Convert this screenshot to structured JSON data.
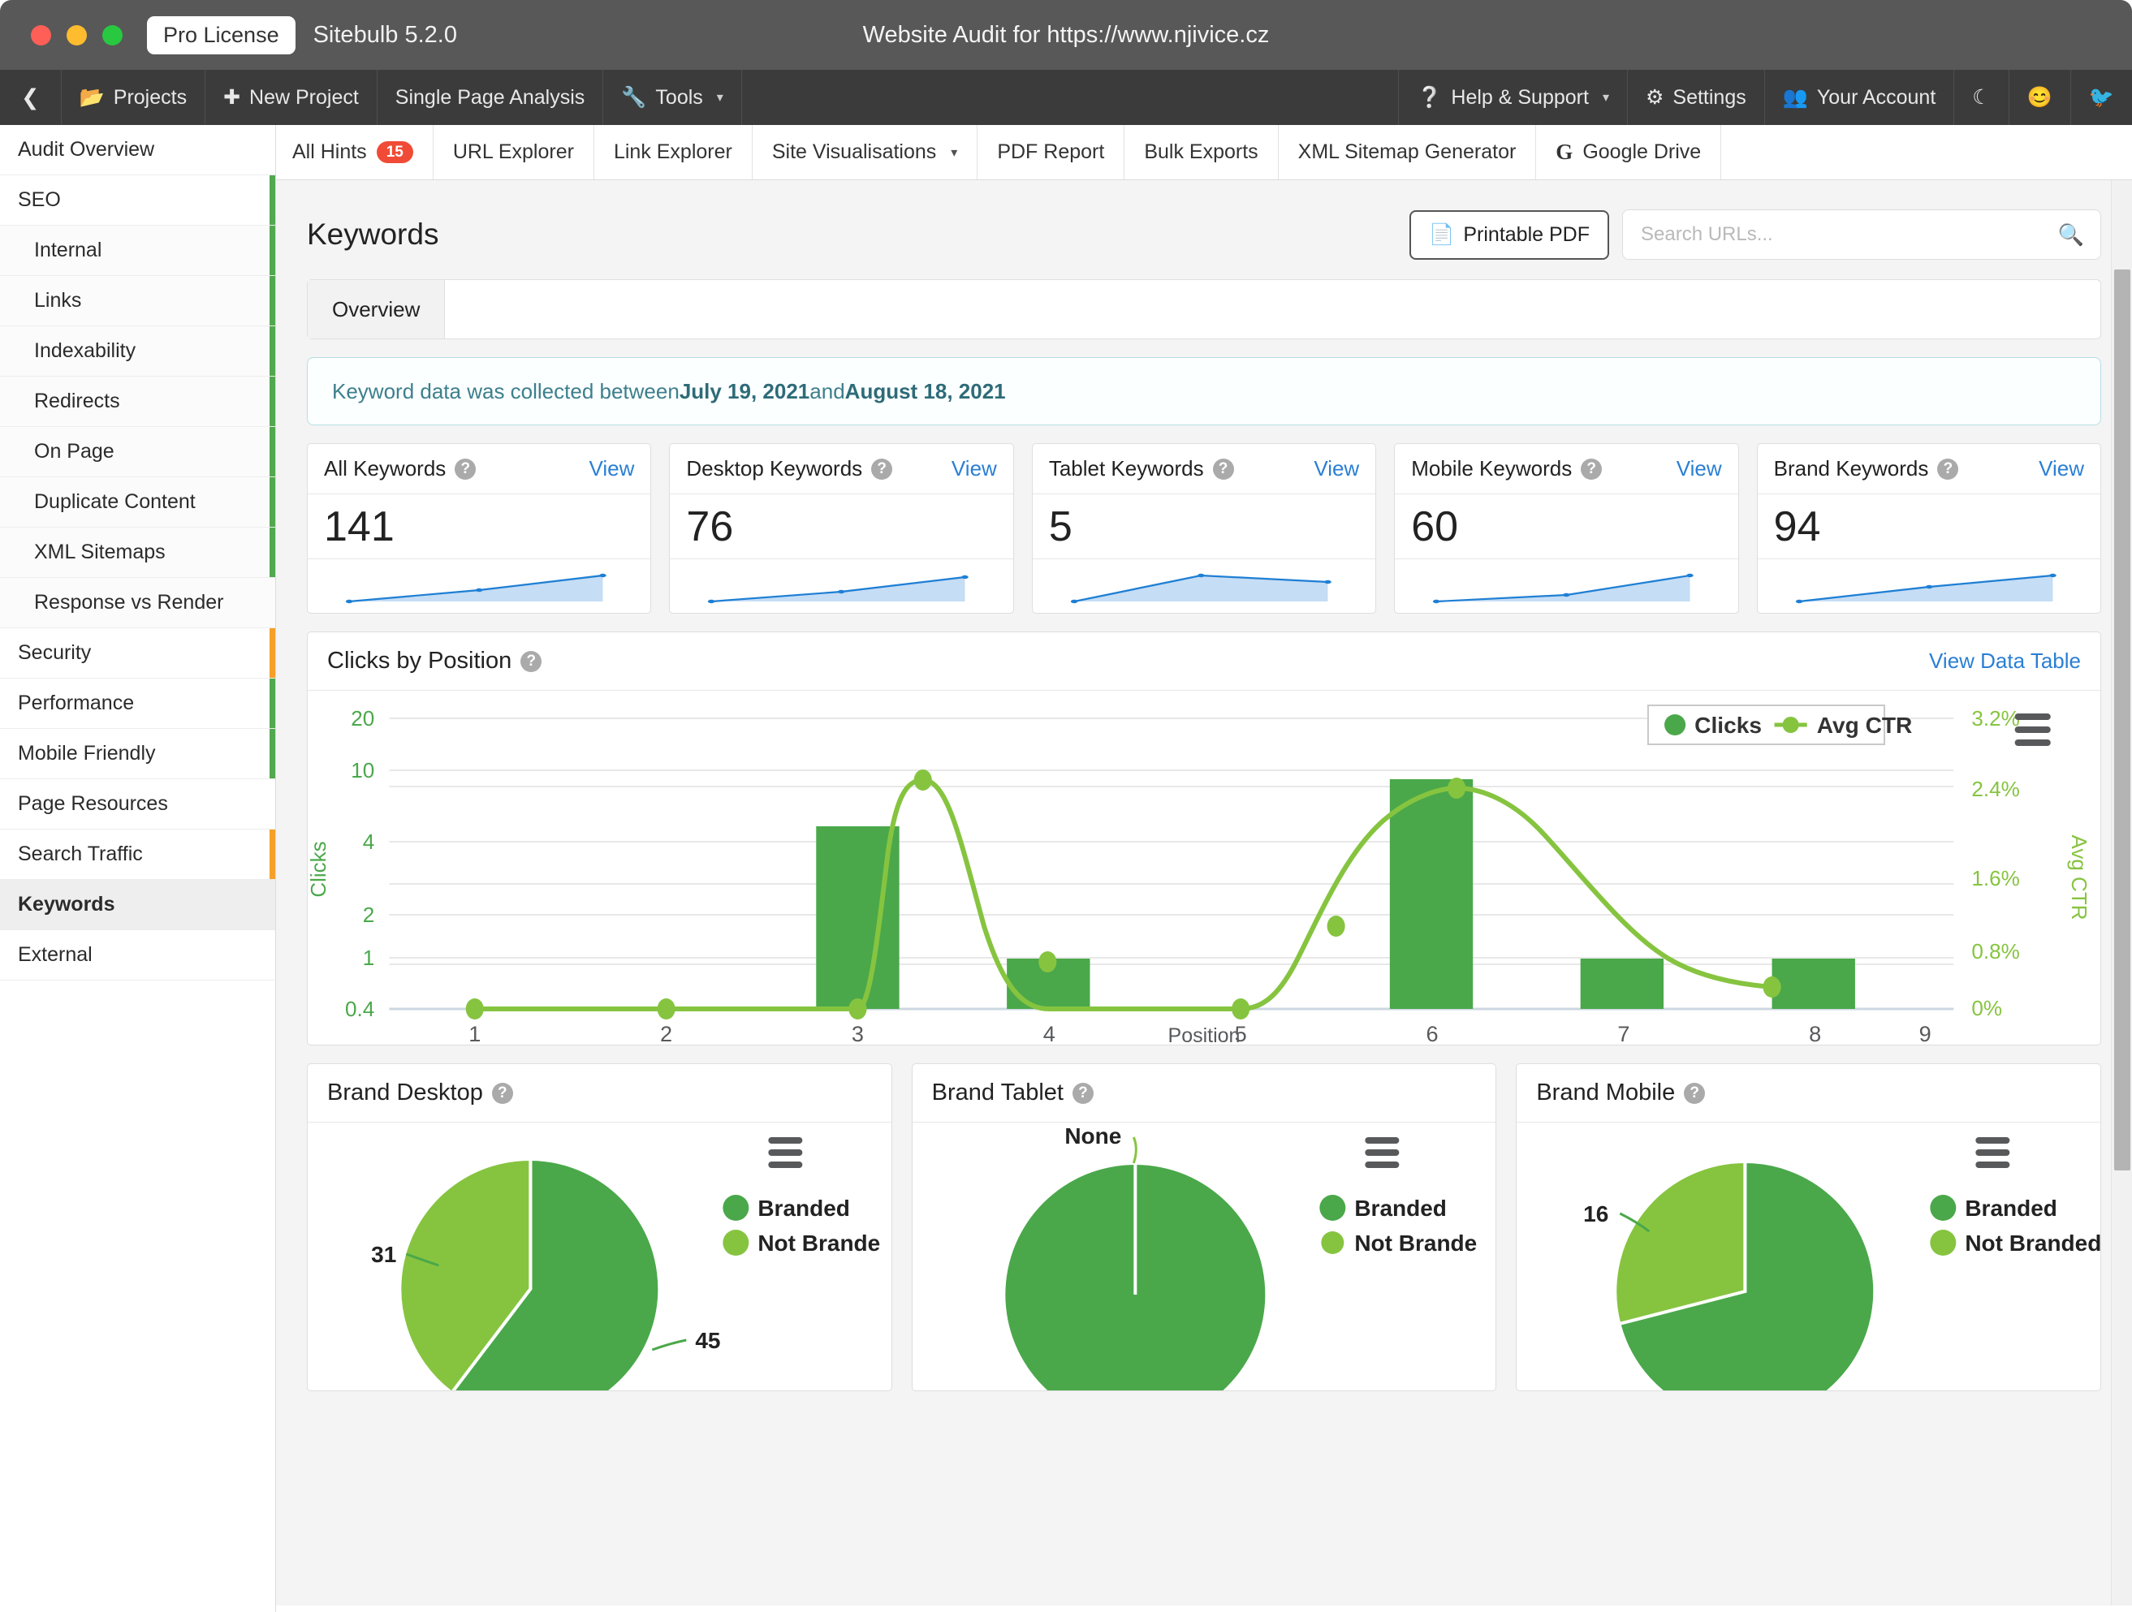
{
  "titlebar": {
    "pro_badge": "Pro License",
    "app_name": "Sitebulb 5.2.0",
    "window_title": "Website Audit for https://www.njivice.cz"
  },
  "menubar": {
    "back_icon": "chevron-left-icon",
    "left_items": [
      {
        "label": "Projects",
        "icon": "folder-icon"
      },
      {
        "label": "New Project",
        "icon": "plus-icon"
      },
      {
        "label": "Single Page Analysis",
        "icon": ""
      },
      {
        "label": "Tools",
        "icon": "wrench-icon",
        "caret": "▾"
      }
    ],
    "right_items": [
      {
        "label": "Help & Support",
        "icon": "question-circle-icon",
        "caret": "▾"
      },
      {
        "label": "Settings",
        "icon": "gears-icon"
      },
      {
        "label": "Your Account",
        "icon": "users-icon"
      },
      {
        "label": "",
        "icon": "moon-icon",
        "glyph": "☾"
      },
      {
        "label": "",
        "icon": "smiley-icon",
        "glyph": "😊"
      },
      {
        "label": "",
        "icon": "twitter-icon",
        "glyph": "🐦"
      }
    ]
  },
  "sidebar": {
    "items": [
      {
        "label": "Audit Overview",
        "level": 0,
        "edge": "",
        "active": false
      },
      {
        "label": "SEO",
        "level": 0,
        "edge": "#52a850",
        "active": false
      },
      {
        "label": "Internal",
        "level": 1,
        "edge": "#52a850",
        "active": false
      },
      {
        "label": "Links",
        "level": 1,
        "edge": "#52a850",
        "active": false
      },
      {
        "label": "Indexability",
        "level": 1,
        "edge": "#52a850",
        "active": false
      },
      {
        "label": "Redirects",
        "level": 1,
        "edge": "#52a850",
        "active": false
      },
      {
        "label": "On Page",
        "level": 1,
        "edge": "#52a850",
        "active": false
      },
      {
        "label": "Duplicate Content",
        "level": 1,
        "edge": "#52a850",
        "active": false
      },
      {
        "label": "XML Sitemaps",
        "level": 1,
        "edge": "#52a850",
        "active": false
      },
      {
        "label": "Response vs Render",
        "level": 1,
        "edge": "",
        "active": false
      },
      {
        "label": "Security",
        "level": 0,
        "edge": "#f5a02a",
        "active": false
      },
      {
        "label": "Performance",
        "level": 0,
        "edge": "#52a850",
        "active": false
      },
      {
        "label": "Mobile Friendly",
        "level": 0,
        "edge": "#52a850",
        "active": false
      },
      {
        "label": "Page Resources",
        "level": 0,
        "edge": "",
        "active": false
      },
      {
        "label": "Search Traffic",
        "level": 0,
        "edge": "#f5a02a",
        "active": false
      },
      {
        "label": "Keywords",
        "level": 0,
        "edge": "",
        "active": true
      },
      {
        "label": "External",
        "level": 0,
        "edge": "",
        "active": false
      }
    ]
  },
  "tabs": [
    {
      "label": "All Hints",
      "badge": "15"
    },
    {
      "label": "URL Explorer",
      "badge": ""
    },
    {
      "label": "Link Explorer",
      "badge": ""
    },
    {
      "label": "Site Visualisations",
      "badge": "",
      "caret": "▾"
    },
    {
      "label": "PDF Report",
      "badge": ""
    },
    {
      "label": "Bulk Exports",
      "badge": ""
    },
    {
      "label": "XML Sitemap Generator",
      "badge": ""
    },
    {
      "label": "Google Drive",
      "badge": "",
      "icon": "google-drive-icon",
      "glyph": "G"
    }
  ],
  "page": {
    "title": "Keywords",
    "printable_pdf_label": "Printable PDF",
    "printable_pdf_icon": "file-pdf-icon",
    "search_placeholder": "Search URLs...",
    "search_value": "",
    "search_icon": "search-icon",
    "subtabs": [
      {
        "label": "Overview",
        "active": true
      }
    ],
    "banner": {
      "prefix": "Keyword data was collected between ",
      "start_date": "July 19, 2021",
      "middle": " and ",
      "end_date": "August 18, 2021"
    }
  },
  "stat_cards": [
    {
      "title": "All Keywords",
      "value": "141",
      "view": "View",
      "spark": [
        8,
        26,
        48
      ]
    },
    {
      "title": "Desktop Keywords",
      "value": "76",
      "view": "View",
      "spark": [
        8,
        26,
        44
      ]
    },
    {
      "title": "Tablet Keywords",
      "value": "5",
      "view": "View",
      "spark": [
        6,
        46,
        34
      ]
    },
    {
      "title": "Mobile Keywords",
      "value": "60",
      "view": "View",
      "spark": [
        6,
        18,
        45
      ]
    },
    {
      "title": "Brand Keywords",
      "value": "94",
      "view": "View",
      "spark": [
        6,
        32,
        48
      ]
    }
  ],
  "clicks_panel": {
    "title": "Clicks by Position",
    "link": "View Data Table",
    "menu_icon": "hamburger-menu-icon"
  },
  "pie_panels": [
    {
      "title": "Brand Desktop",
      "menu_icon": "hamburger-menu-icon"
    },
    {
      "title": "Brand Tablet",
      "menu_icon": "hamburger-menu-icon"
    },
    {
      "title": "Brand Mobile",
      "menu_icon": "hamburger-menu-icon"
    }
  ],
  "chart_data": [
    {
      "type": "bar",
      "title": "Clicks by Position",
      "xlabel": "Position",
      "ylabel": "Clicks",
      "y2label": "Avg CTR",
      "categories": [
        "1",
        "2",
        "3",
        "4",
        "5",
        "6",
        "7",
        "8",
        "9"
      ],
      "yticks": [
        "0.4",
        "1",
        "2",
        "4",
        "10",
        "20"
      ],
      "y2ticks": [
        "0%",
        "0.8%",
        "1.6%",
        "2.4%",
        "3.2%"
      ],
      "ylim": [
        0.4,
        20
      ],
      "y2lim": [
        0,
        3.2
      ],
      "yscale": "log",
      "grid": true,
      "legend": "top-right",
      "series": [
        {
          "name": "Clicks",
          "type": "bar",
          "values": [
            0,
            0,
            0,
            5,
            1,
            0,
            11,
            1,
            1
          ]
        },
        {
          "name": "Avg CTR",
          "type": "line",
          "values": [
            0,
            0,
            0,
            2.65,
            0.78,
            0,
            1.25,
            2.86,
            0.5
          ]
        }
      ],
      "colors": {
        "clicks": "#4aa84a",
        "avg_ctr": "#86c440"
      }
    },
    {
      "type": "pie",
      "title": "Brand Desktop",
      "labels": [
        "Branded",
        "Not Branded"
      ],
      "values": [
        45,
        31
      ],
      "data_labels": [
        "45",
        "31"
      ],
      "colors": [
        "#4aa84a",
        "#86c440"
      ],
      "legend": "right"
    },
    {
      "type": "pie",
      "title": "Brand Tablet",
      "labels": [
        "Branded",
        "Not Branded"
      ],
      "values": [
        5,
        0
      ],
      "data_labels": [
        "None"
      ],
      "colors": [
        "#4aa84a",
        "#86c440"
      ],
      "legend": "right"
    },
    {
      "type": "pie",
      "title": "Brand Mobile",
      "labels": [
        "Branded",
        "Not Branded"
      ],
      "values": [
        44,
        16
      ],
      "data_labels": [
        "16"
      ],
      "colors": [
        "#4aa84a",
        "#86c440"
      ],
      "legend": "right"
    }
  ],
  "pie_legend": {
    "branded": "Branded",
    "not_branded": "Not Branded",
    "not_branded_clipped": "Not Brande"
  }
}
